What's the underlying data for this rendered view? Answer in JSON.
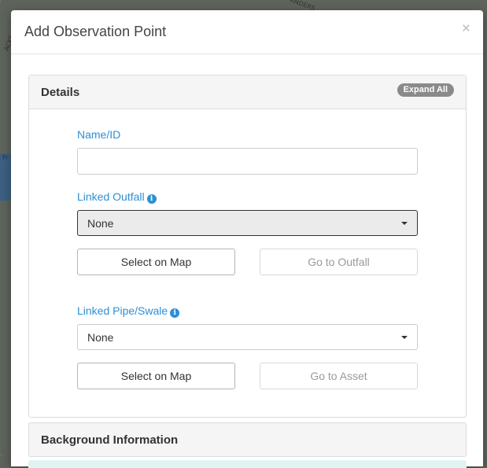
{
  "map": {
    "labels": [
      "ANDERS",
      "ACKS",
      "Fr"
    ]
  },
  "modal": {
    "title": "Add Observation Point",
    "close_symbol": "×"
  },
  "details": {
    "title": "Details",
    "expand_all": "Expand All",
    "name_label": "Name/ID",
    "name_value": "",
    "linked_outfall": {
      "label": "Linked Outfall",
      "selected": "None",
      "select_on_map": "Select on Map",
      "go_to": "Go to Outfall"
    },
    "linked_pipe": {
      "label": "Linked Pipe/Swale",
      "selected": "None",
      "select_on_map": "Select on Map",
      "go_to": "Go to Asset"
    }
  },
  "background": {
    "title": "Background Information"
  },
  "colors": {
    "accent": "#2d8fd6",
    "badge": "#8a8a8a"
  }
}
